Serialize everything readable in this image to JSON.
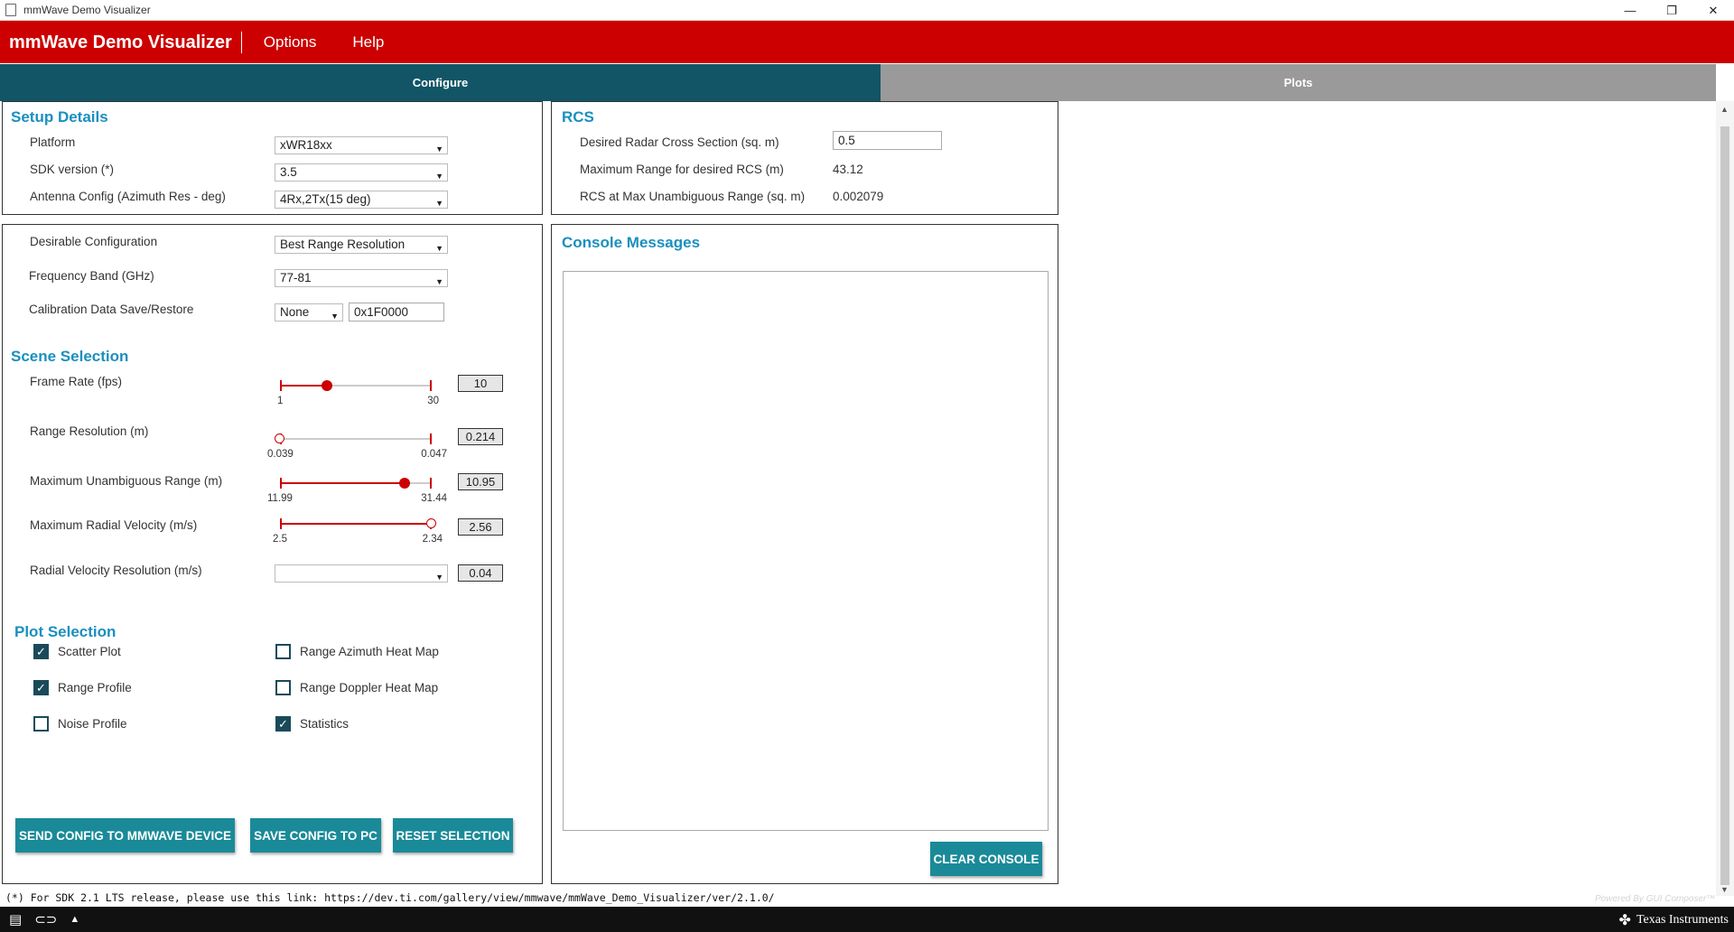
{
  "window": {
    "title": "mmWave Demo Visualizer",
    "minimize": "—",
    "restore": "❐",
    "close": "✕"
  },
  "header": {
    "brand": "mmWave Demo Visualizer",
    "menu": [
      "Options",
      "Help"
    ]
  },
  "tabs": {
    "configure": "Configure",
    "plots": "Plots"
  },
  "setup": {
    "title": "Setup Details",
    "platform": {
      "label": "Platform",
      "value": "xWR18xx"
    },
    "sdk": {
      "label": "SDK version (*)",
      "value": "3.5"
    },
    "antenna": {
      "label": "Antenna Config (Azimuth Res - deg)",
      "value": "4Rx,2Tx(15 deg)"
    }
  },
  "rcs": {
    "title": "RCS",
    "desired": {
      "label": "Desired Radar Cross Section (sq. m)",
      "value": "0.5"
    },
    "maxrange": {
      "label": "Maximum Range for desired RCS (m)",
      "value": "43.12"
    },
    "rcsmax": {
      "label": "RCS at Max Unambiguous Range (sq. m)",
      "value": "0.002079"
    }
  },
  "config": {
    "desirable": {
      "label": "Desirable Configuration",
      "value": "Best Range Resolution"
    },
    "band": {
      "label": "Frequency Band (GHz)",
      "value": "77-81"
    },
    "calib": {
      "label": "Calibration Data Save/Restore",
      "value": "None",
      "address": "0x1F0000"
    }
  },
  "scene": {
    "title": "Scene Selection",
    "frame_rate": {
      "label": "Frame Rate (fps)",
      "min": "1",
      "max": "30",
      "value": "10",
      "fraction": 0.31
    },
    "range_res": {
      "label": "Range Resolution (m)",
      "min": "0.039",
      "max": "0.047",
      "value": "0.214",
      "fraction": 0.0
    },
    "max_range": {
      "label": "Maximum Unambiguous Range (m)",
      "min": "11.99",
      "max": "31.44",
      "value": "10.95",
      "fraction": 0.82
    },
    "max_vel": {
      "label": "Maximum Radial Velocity (m/s)",
      "min": "2.5",
      "max": "2.34",
      "value": "2.56",
      "fraction": 1.0
    },
    "vel_res": {
      "label": "Radial Velocity Resolution (m/s)",
      "value": "0.04",
      "select": ""
    }
  },
  "plots": {
    "title": "Plot Selection",
    "scatter": {
      "label": "Scatter Plot",
      "checked": true
    },
    "range_profile": {
      "label": "Range Profile",
      "checked": true
    },
    "noise_profile": {
      "label": "Noise Profile",
      "checked": false
    },
    "range_azimuth": {
      "label": "Range Azimuth Heat Map",
      "checked": false
    },
    "range_doppler": {
      "label": "Range Doppler Heat Map",
      "checked": false
    },
    "statistics": {
      "label": "Statistics",
      "checked": true
    }
  },
  "buttons": {
    "send": "SEND CONFIG TO MMWAVE DEVICE",
    "save": "SAVE CONFIG TO PC",
    "reset": "RESET SELECTION",
    "clear": "CLEAR CONSOLE"
  },
  "console": {
    "title": "Console Messages"
  },
  "footnote": "(*) For SDK 2.1 LTS release, please use this link: https://dev.ti.com/gallery/view/mmwave/mmWave_Demo_Visualizer/ver/2.1.0/",
  "powered_by": "Powered By GUI Composer™",
  "brand_footer": "Texas Instruments",
  "colors": {
    "header_red": "#cc0000",
    "tab_active": "#115566",
    "accent_blue": "#1a8fbf",
    "button_teal": "#1a8a99"
  }
}
